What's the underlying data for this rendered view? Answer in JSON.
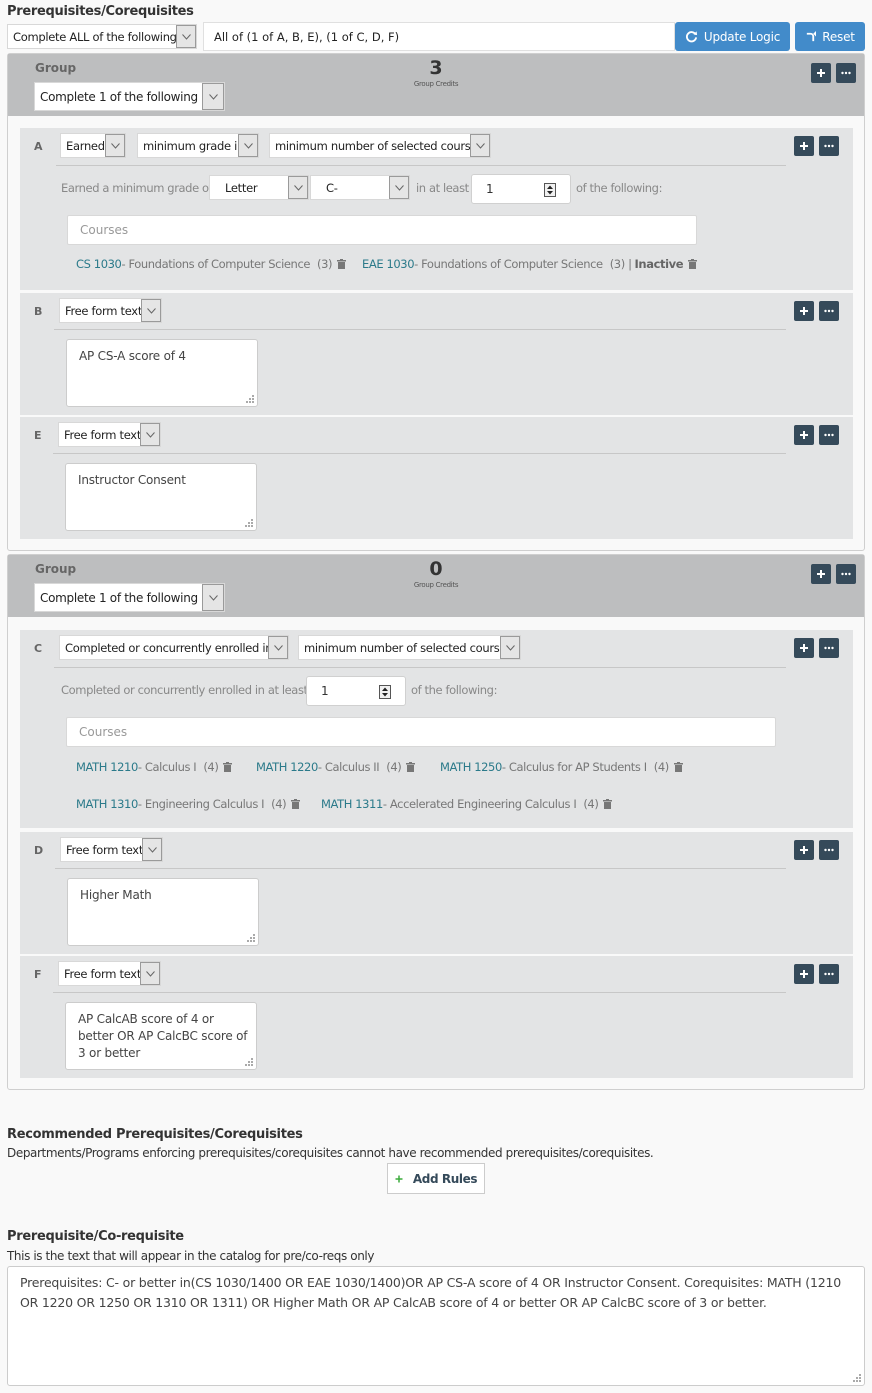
{
  "header": {
    "title": "Prerequisites/Corequisites",
    "top_select": "Complete ALL of the following",
    "logic_value": "All of (1 of A, B, E), (1 of C, D, F)",
    "update_logic_label": "Update Logic",
    "reset_label": "Reset"
  },
  "groups": [
    {
      "label": "Group",
      "credits": "3",
      "credits_label": "Group Credits",
      "select": "Complete 1 of the following",
      "rules": [
        {
          "letter": "A",
          "type": "Earned",
          "grade_mode": "minimum grade in",
          "count_mode": "minimum number of selected courses",
          "grade_prefix": "Earned a minimum grade of",
          "grade_scale": "Letter",
          "grade_value": "C-",
          "at_least_label": "in at least",
          "at_least_value": "1",
          "of_following": "of the following:",
          "courses_placeholder": "Courses",
          "courses": [
            {
              "code": "CS 1030",
              "title": " - Foundations of Computer Science",
              "credits": "(3)",
              "status": ""
            },
            {
              "code": "EAE 1030",
              "title": " - Foundations of Computer Science",
              "credits": "(3) |",
              "status": "Inactive"
            }
          ]
        },
        {
          "letter": "B",
          "type": "Free form text",
          "text": "AP CS-A score of 4"
        },
        {
          "letter": "E",
          "type": "Free form text",
          "text": "Instructor Consent"
        }
      ]
    },
    {
      "label": "Group",
      "credits": "0",
      "credits_label": "Group Credits",
      "select": "Complete 1 of the following",
      "rules": [
        {
          "letter": "C",
          "type": "Completed or concurrently enrolled in",
          "count_mode": "minimum number of selected courses",
          "at_least_label": "Completed or concurrently enrolled in at least",
          "at_least_value": "1",
          "of_following": "of the following:",
          "courses_placeholder": "Courses",
          "courses": [
            {
              "code": "MATH 1210",
              "title": " - Calculus I",
              "credits": "(4)"
            },
            {
              "code": "MATH 1220",
              "title": " - Calculus II",
              "credits": "(4)"
            },
            {
              "code": "MATH 1250",
              "title": " - Calculus for AP Students I",
              "credits": "(4)"
            },
            {
              "code": "MATH 1310",
              "title": " - Engineering Calculus I",
              "credits": "(4)"
            },
            {
              "code": "MATH 1311",
              "title": " - Accelerated Engineering Calculus I",
              "credits": "(4)"
            }
          ]
        },
        {
          "letter": "D",
          "type": "Free form text",
          "text": "Higher Math"
        },
        {
          "letter": "F",
          "type": "Free form text",
          "text": "AP CalcAB score of 4 or better OR AP CalcBC score of 3 or better"
        }
      ]
    }
  ],
  "recommended": {
    "title": "Recommended Prerequisites/Corequisites",
    "note": "Departments/Programs enforcing prerequisites/corequisites cannot have recommended prerequisites/corequisites.",
    "add_rules_label": "Add Rules"
  },
  "catalog": {
    "title": "Prerequisite/Co-requisite",
    "note": "This is the text that will appear in the catalog for pre/co-reqs only",
    "text": "Prerequisites: C- or better in(CS 1030/1400 OR EAE 1030/1400)OR AP CS-A score of 4 OR Instructor Consent. Corequisites: MATH (1210 OR 1220 OR 1250 OR 1310 OR 1311) OR Higher Math OR AP CalcAB score of 4 or better OR AP CalcBC score of 3 or better."
  },
  "colors": {
    "primary_button": "#428bca",
    "icon_button": "#354a5a",
    "course_link": "#2b7a8a",
    "group_header": "#bdbebf",
    "rule_bg": "#e3e4e5",
    "add_icon": "#3cab3c"
  }
}
